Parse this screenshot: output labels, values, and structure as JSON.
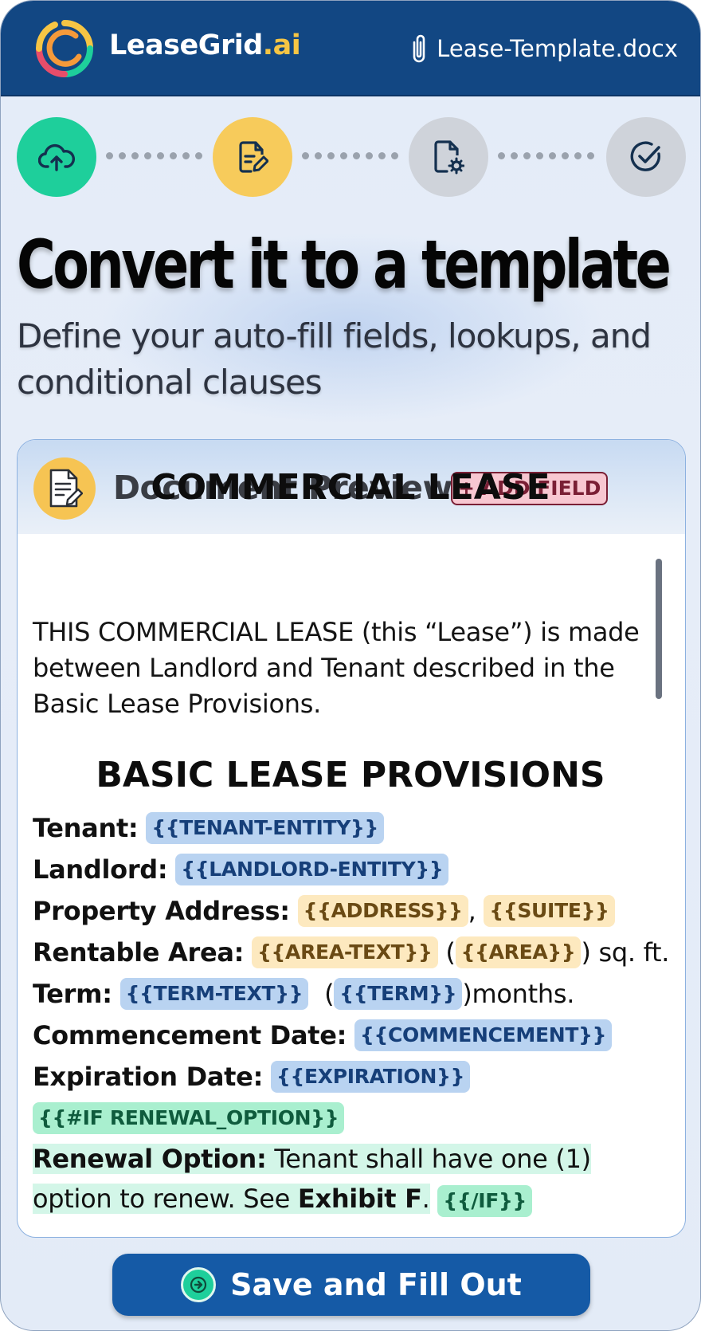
{
  "app": {
    "brand_main": "LeaseGrid",
    "brand_suffix": ".ai",
    "file_name": "Lease-Template.docx"
  },
  "stepper": {
    "steps": [
      {
        "icon": "cloud-upload-icon",
        "state": "done",
        "color": "#1ecf9b"
      },
      {
        "icon": "document-edit-icon",
        "state": "current",
        "color": "#f7cb5b"
      },
      {
        "icon": "document-settings-icon",
        "state": "pending",
        "color": "#cfd3da"
      },
      {
        "icon": "check-circle-icon",
        "state": "pending",
        "color": "#cfd3da"
      }
    ]
  },
  "heading": {
    "title": "Convert it to a template",
    "subtitle": "Define your auto-fill fields, lookups, and conditional clauses"
  },
  "preview": {
    "title": "Document Preview",
    "add_field_label": "+ ADD FIELD",
    "doc_title": "COMMERCIAL LEASE",
    "intro": "THIS COMMERCIAL LEASE (this “Lease”) is made between Landlord and Tenant described in the Basic Lease Provisions.",
    "section_title": "BASIC LEASE PROVISIONS",
    "fields": {
      "tenant_label": "Tenant:",
      "tenant_tag": "{{TENANT-ENTITY}}",
      "landlord_label": "Landlord:",
      "landlord_tag": "{{LANDLORD-ENTITY}}",
      "address_label": "Property Address:",
      "address_tag": "{{ADDRESS}}",
      "address_sep": ",",
      "suite_tag": "{{SUITE}}",
      "area_label": "Rentable Area:",
      "area_text_tag": "{{AREA-TEXT}}",
      "area_open": "(",
      "area_tag": "{{AREA}}",
      "area_close": ") sq. ft.",
      "term_label": "Term:",
      "term_text_tag": "{{TERM-TEXT}}",
      "term_open": "(",
      "term_tag": "{{TERM}}",
      "term_close": ")months.",
      "commencement_label": "Commencement Date:",
      "commencement_tag": "{{COMMENCEMENT}}",
      "expiration_label": "Expiration Date:",
      "expiration_tag": "{{EXPIRATION}}",
      "if_tag": "{{#IF RENEWAL_OPTION}}",
      "renewal_label": "Renewal Option:",
      "renewal_text": "Tenant shall have one (1) option to renew. See",
      "renewal_exhibit": "Exhibit F",
      "renewal_period": ".",
      "endif_tag": "{{/IF}}"
    }
  },
  "footer": {
    "save_label": "Save and Fill Out"
  },
  "colors": {
    "header": "#124783",
    "accent_green": "#1ecf9b",
    "accent_yellow": "#f7cb5b",
    "tag_blue": "#b9d3f1",
    "tag_yellow": "#fde9bf",
    "tag_green": "#a9efcf"
  }
}
